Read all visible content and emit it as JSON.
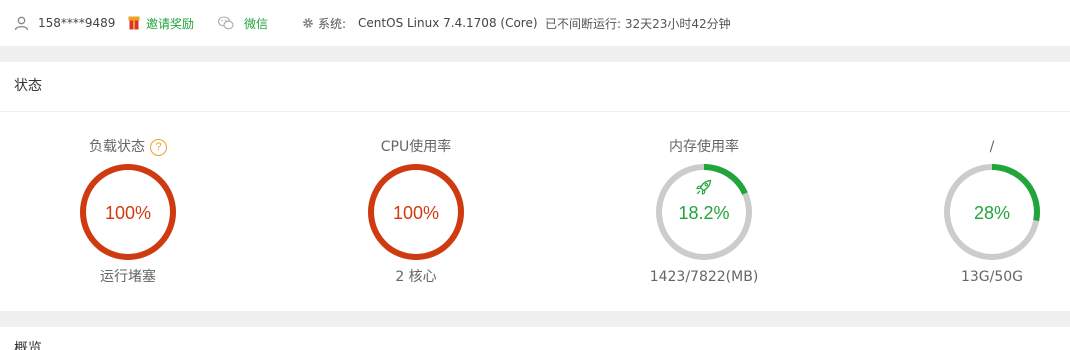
{
  "header": {
    "user": "158****9489",
    "invite_label": "邀请奖励",
    "wechat_label": "微信",
    "system_label": "系统:",
    "system_os": "CentOS Linux 7.4.1708 (Core)",
    "uptime": "已不间断运行: 32天23小时42分钟"
  },
  "status_panel": {
    "title": "状态",
    "gauges": [
      {
        "title": "负载状态",
        "value_text": "100%",
        "percent": 100,
        "subtitle": "运行堵塞",
        "color": "#d03a10",
        "has_help": true,
        "icon": "question-icon"
      },
      {
        "title": "CPU使用率",
        "value_text": "100%",
        "percent": 100,
        "subtitle": "2 核心",
        "color": "#d03a10"
      },
      {
        "title": "内存使用率",
        "value_text": "18.2%",
        "percent": 18.2,
        "subtitle": "1423/7822(MB)",
        "color": "#20a53a",
        "icon": "rocket-icon"
      },
      {
        "title": "/",
        "value_text": "28%",
        "percent": 28,
        "subtitle": "13G/50G",
        "color": "#20a53a"
      }
    ]
  },
  "overview_panel": {
    "title": "概览"
  },
  "colors": {
    "accent": "#20a53a",
    "danger": "#d03a10",
    "track": "#cccccc"
  }
}
